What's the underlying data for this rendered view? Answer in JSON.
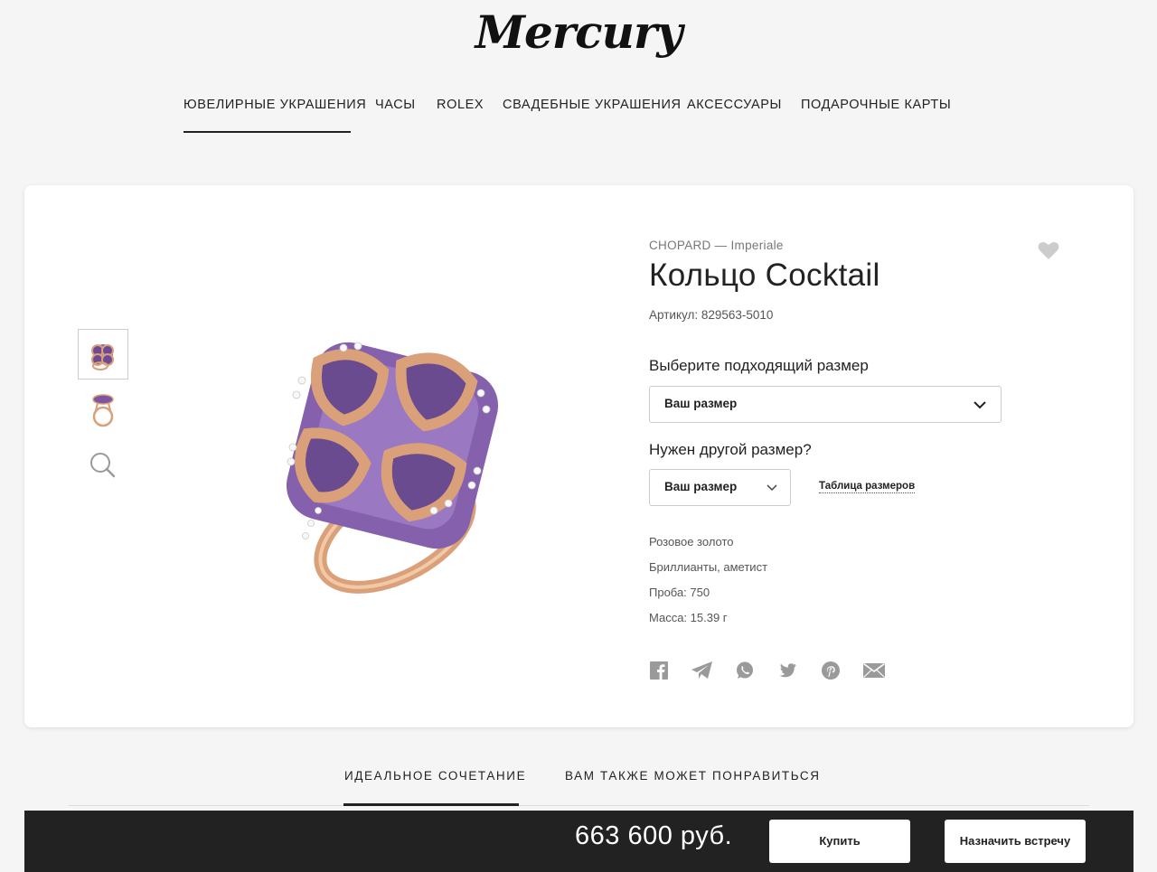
{
  "header": {
    "logo": "Mercury"
  },
  "nav": {
    "items": [
      "ЮВЕЛИРНЫЕ УКРАШЕНИЯ",
      "ЧАСЫ",
      "ROLEX",
      "СВАДЕБНЫЕ УКРАШЕНИЯ",
      "АКСЕССУАРЫ",
      "ПОДАРОЧНЫЕ КАРТЫ"
    ],
    "active_index": 0
  },
  "gallery": {
    "thumbnails": [
      "ring-front-thumbnail",
      "ring-side-thumbnail"
    ],
    "zoom_icon": "magnifier-icon",
    "active_index": 0
  },
  "product": {
    "brand_line": "CHOPARD — Imperiale",
    "title": "Кольцо Cocktail",
    "sku": "Артикул: 829563-5010",
    "favorite_icon": "heart-icon",
    "size_label": "Выберите подходящий размер",
    "size_select_value": "Ваш размер",
    "other_size_label": "Нужен другой размер?",
    "other_size_select_value": "Ваш размер",
    "size_table_link": "Таблица размеров",
    "specs": [
      "Розовое золото",
      "Бриллианты, аметист",
      "Проба: 750",
      "Масса: 15.39 г"
    ],
    "share_icons": [
      "facebook-icon",
      "telegram-icon",
      "whatsapp-icon",
      "twitter-icon",
      "pinterest-icon",
      "email-icon"
    ]
  },
  "tabs": {
    "items": [
      "ИДЕАЛЬНОЕ СОЧЕТАНИЕ",
      "ВАМ ТАКЖЕ МОЖЕТ ПОНРАВИТЬСЯ"
    ],
    "active_index": 0
  },
  "buy_bar": {
    "price": "663 600 руб.",
    "buy_button": "Купить",
    "appointment_button": "Назначить встречу"
  },
  "colors": {
    "background": "#f5f5f5",
    "text": "#222222",
    "buy_bar": "#232222",
    "rose_gold": "#d9a07a",
    "amethyst": "#7f5aa6",
    "icon_grey": "#9a9a9a"
  }
}
